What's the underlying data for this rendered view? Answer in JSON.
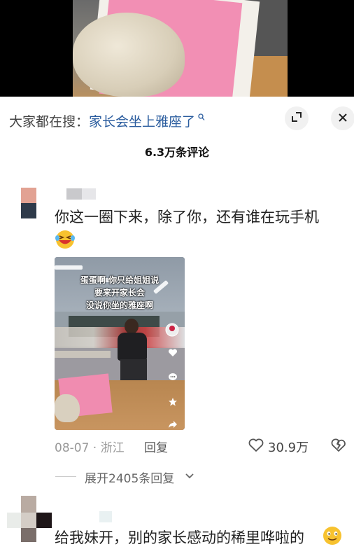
{
  "search_bar": {
    "prefix": "大家都在搜：",
    "query": "家长会坐上雅座了"
  },
  "icons": {
    "search": "search-icon",
    "expand": "expand-icon",
    "close": "close-icon",
    "like": "heart-icon",
    "dislike": "broken-heart-icon",
    "chevron": "chevron-down-icon"
  },
  "comments_header": {
    "count": "6.3万条评论"
  },
  "comment1": {
    "text": "你这一圈下来，除了你，还有谁在玩手机",
    "emoji": "😂",
    "video": {
      "caption_lines": [
        "蛋蛋啊 你只给姐姐说",
        "要来开家长会",
        "没说你坐的雅座啊"
      ]
    },
    "date_location": "08-07 · 浙江",
    "reply_label": "回复",
    "likes": "30.9万",
    "expand_replies": "展开2405条回复"
  },
  "comment2": {
    "text": "给我妹开，别的家长感动的稀里哗啦的",
    "emoji": "🙂"
  },
  "colors": {
    "link": "#2a5c9e",
    "muted": "#999999",
    "pink": "#f28fb4"
  }
}
